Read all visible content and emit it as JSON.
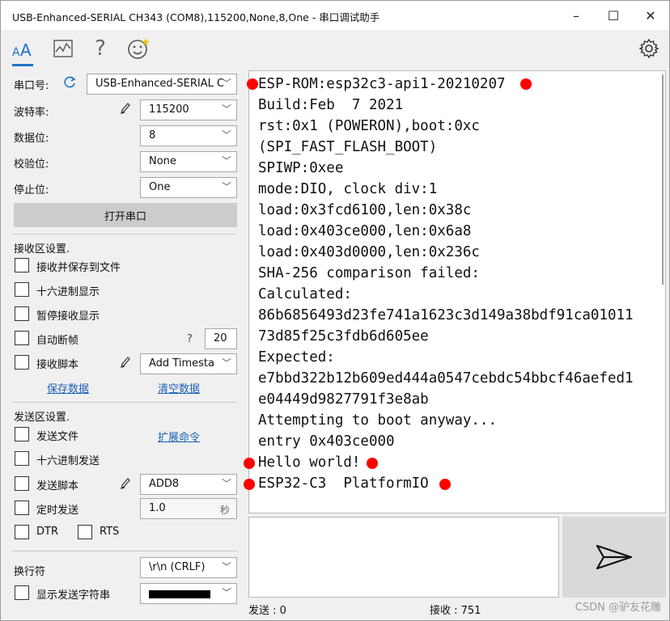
{
  "window": {
    "title": "USB-Enhanced-SERIAL CH343 (COM8),115200,None,8,One - 串口调试助手",
    "minimize": "–",
    "maximize": "☐",
    "close": "✕"
  },
  "toolbar": {
    "icons": [
      "font-icon",
      "chart-icon",
      "help-icon",
      "smiley-icon",
      "gear-icon"
    ],
    "font_glyph": "AA",
    "help_glyph": "?"
  },
  "serial": {
    "port_label": "串口号:",
    "port_value": "USB-Enhanced-SERIAL C",
    "baud_label": "波特率:",
    "baud_value": "115200",
    "databits_label": "数据位:",
    "databits_value": "8",
    "parity_label": "校验位:",
    "parity_value": "None",
    "stopbits_label": "停止位:",
    "stopbits_value": "One",
    "open_button": "打开串口"
  },
  "receive_settings": {
    "title": "接收区设置.",
    "save_to_file": "接收并保存到文件",
    "hex_display": "十六进制显示",
    "pause_display": "暂停接收显示",
    "auto_frame": "自动断帧",
    "frame_help": "?",
    "frame_value": "20",
    "script": "接收脚本",
    "script_value": "Add Timesta",
    "save_data": "保存数据",
    "clear_data": "清空数据"
  },
  "send_settings": {
    "title": "发送区设置.",
    "send_file": "发送文件",
    "extend_cmd": "扩展命令",
    "hex_send": "十六进制发送",
    "script": "发送脚本",
    "script_value": "ADD8",
    "timed_send": "定时发送",
    "timed_value": "1.0",
    "timed_unit": "秒",
    "dtr": "DTR",
    "rts": "RTS",
    "newline_label": "换行符",
    "newline_value": "\\r\\n (CRLF)",
    "show_send": "显示发送字符串"
  },
  "receive_lines": [
    "ESP-ROM:esp32c3-api1-20210207",
    "Build:Feb  7 2021",
    "rst:0x1 (POWERON),boot:0xc",
    "(SPI_FAST_FLASH_BOOT)",
    "SPIWP:0xee",
    "mode:DIO, clock div:1",
    "load:0x3fcd6100,len:0x38c",
    "load:0x403ce000,len:0x6a8",
    "load:0x403d0000,len:0x236c",
    "SHA-256 comparison failed:",
    "Calculated:",
    "86b6856493d23fe741a1623c3d149a38bdf91ca01011",
    "73d85f25c3fdb6d605ee",
    "Expected:",
    "e7bbd322b12b609ed444a0547cebdc54bbcf46aefed1",
    "e04449d9827791f3e8ab",
    "Attempting to boot anyway...",
    "entry 0x403ce000",
    "Hello world!",
    "ESP32-C3  PlatformIO"
  ],
  "status": {
    "sent": "发送 : 0",
    "received": "接收 : 751",
    "watermark": "CSDN @驴友花雕"
  },
  "colors": {
    "accent": "#1e74c9",
    "marker": "#ff0000",
    "link": "#1a5fb4"
  }
}
